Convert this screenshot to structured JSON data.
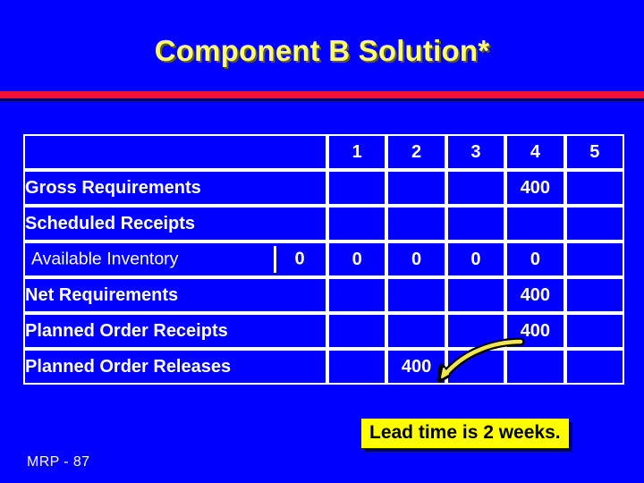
{
  "slide": {
    "title": "Component B Solution*",
    "footer": "MRP - 87",
    "callout": "Lead time is 2 weeks.",
    "colors": {
      "background": "#0000ff",
      "title_text": "#ffff66",
      "rule": "#ef1233",
      "grid_line": "#ffffff",
      "cell_text": "#ffffff",
      "callout_bg": "#ffff00",
      "callout_text": "#000000",
      "arrow": "#f2e84c"
    }
  },
  "table": {
    "corner_label": "",
    "period_headers": [
      "1",
      "2",
      "3",
      "4",
      "5"
    ],
    "rows": [
      {
        "label": "Gross Requirements",
        "beginning": null,
        "values": [
          "",
          "",
          "",
          "400",
          ""
        ]
      },
      {
        "label": "Scheduled Receipts",
        "beginning": null,
        "values": [
          "",
          "",
          "",
          "",
          ""
        ]
      },
      {
        "label": "Available Inventory",
        "beginning": "0",
        "values": [
          "0",
          "0",
          "0",
          "0",
          ""
        ]
      },
      {
        "label": "Net Requirements",
        "beginning": null,
        "values": [
          "",
          "",
          "",
          "400",
          ""
        ]
      },
      {
        "label": "Planned Order Receipts",
        "beginning": null,
        "values": [
          "",
          "",
          "",
          "400",
          ""
        ]
      },
      {
        "label": "Planned Order Releases",
        "beginning": null,
        "values": [
          "",
          "400",
          "",
          "",
          ""
        ]
      }
    ]
  },
  "annotation": {
    "arrow_from": "Planned Order Receipts period 4",
    "arrow_to": "Planned Order Releases period 2",
    "offset_weeks": "2"
  }
}
